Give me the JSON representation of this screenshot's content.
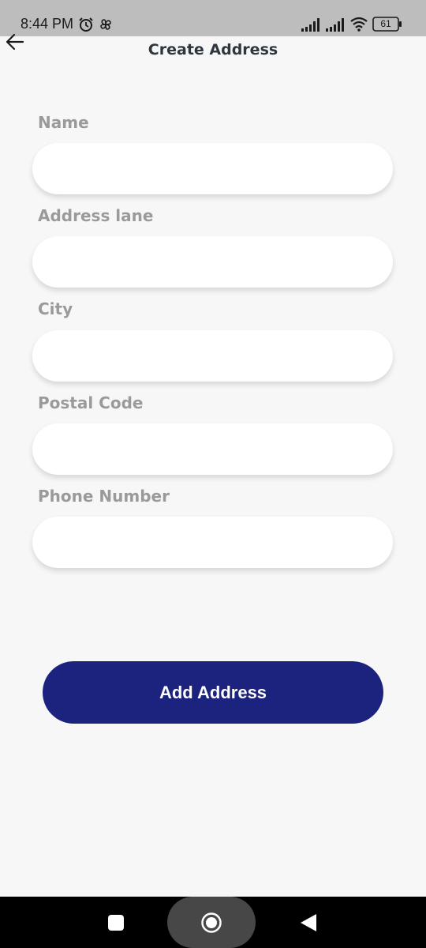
{
  "status_bar": {
    "time": "8:44 PM",
    "battery_level": "61",
    "icons": [
      "alarm-icon",
      "pinwheel-icon",
      "signal-icon",
      "signal-icon",
      "wifi-icon",
      "battery-icon"
    ]
  },
  "header": {
    "title": "Create Address",
    "back_icon": "arrow-left-icon"
  },
  "form": {
    "fields": [
      {
        "label": "Name",
        "value": "",
        "placeholder": ""
      },
      {
        "label": "Address lane",
        "value": "",
        "placeholder": ""
      },
      {
        "label": "City",
        "value": "",
        "placeholder": ""
      },
      {
        "label": "Postal Code",
        "value": "",
        "placeholder": ""
      },
      {
        "label": "Phone Number",
        "value": "",
        "placeholder": ""
      }
    ],
    "submit_label": "Add Address"
  },
  "nav_bar": {
    "icons": [
      "square-icon",
      "home-circle-icon",
      "back-triangle-icon"
    ]
  },
  "colors": {
    "primary": "#1c237e",
    "background": "#f7f7f7",
    "label": "#9a9a9a",
    "title": "#2e3640",
    "status_bar": "#bdbdbd"
  }
}
